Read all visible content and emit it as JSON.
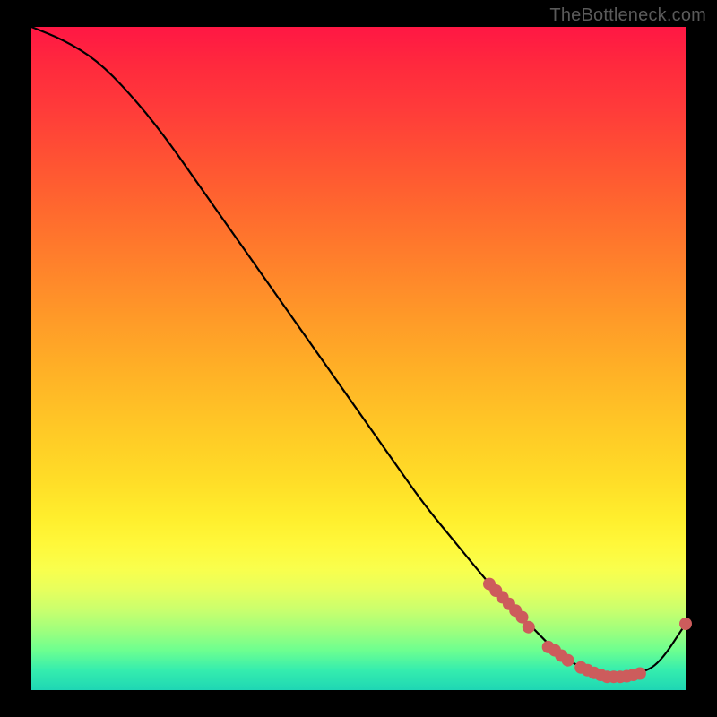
{
  "watermark": "TheBottleneck.com",
  "chart_data": {
    "type": "line",
    "title": "",
    "xlabel": "",
    "ylabel": "",
    "xlim": [
      0,
      100
    ],
    "ylim": [
      0,
      100
    ],
    "grid": false,
    "series": [
      {
        "name": "bottleneck-curve",
        "x": [
          0,
          5,
          10,
          15,
          20,
          25,
          30,
          35,
          40,
          45,
          50,
          55,
          60,
          65,
          70,
          72,
          75,
          78,
          80,
          82,
          85,
          88,
          90,
          93,
          96,
          100
        ],
        "values": [
          100,
          98,
          95,
          90,
          84,
          77,
          70,
          63,
          56,
          49,
          42,
          35,
          28,
          22,
          16,
          14,
          11,
          8,
          6,
          4.5,
          3,
          2,
          2,
          2.5,
          4,
          10
        ]
      }
    ],
    "markers": {
      "name": "highlight-points",
      "color": "#cd5c5c",
      "points": [
        {
          "x": 70,
          "y": 16
        },
        {
          "x": 71,
          "y": 15
        },
        {
          "x": 72,
          "y": 14
        },
        {
          "x": 73,
          "y": 13
        },
        {
          "x": 74,
          "y": 12
        },
        {
          "x": 75,
          "y": 11
        },
        {
          "x": 76,
          "y": 9.5
        },
        {
          "x": 79,
          "y": 6.5
        },
        {
          "x": 80,
          "y": 6
        },
        {
          "x": 81,
          "y": 5.2
        },
        {
          "x": 82,
          "y": 4.5
        },
        {
          "x": 84,
          "y": 3.4
        },
        {
          "x": 85,
          "y": 3
        },
        {
          "x": 86,
          "y": 2.6
        },
        {
          "x": 87,
          "y": 2.3
        },
        {
          "x": 88,
          "y": 2
        },
        {
          "x": 89,
          "y": 2
        },
        {
          "x": 90,
          "y": 2
        },
        {
          "x": 91,
          "y": 2.1
        },
        {
          "x": 92,
          "y": 2.3
        },
        {
          "x": 93,
          "y": 2.5
        },
        {
          "x": 100,
          "y": 10
        }
      ]
    }
  }
}
